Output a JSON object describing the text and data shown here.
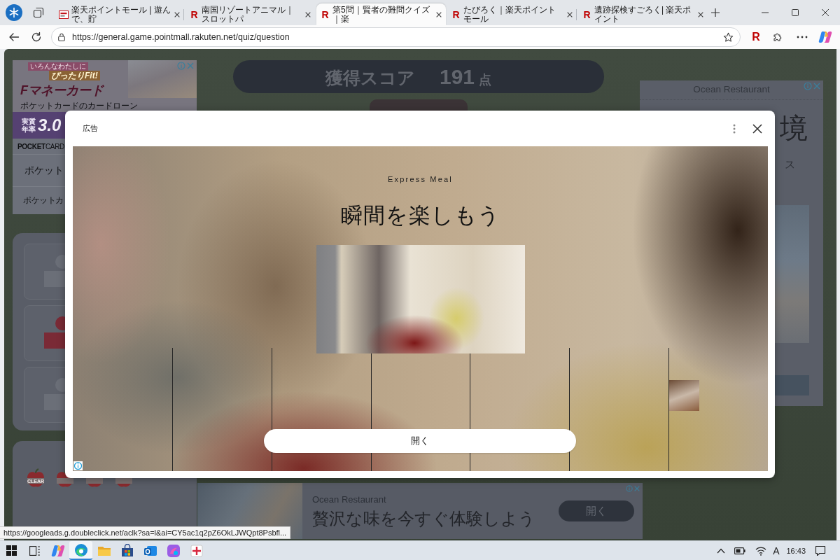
{
  "browser": {
    "tabs": [
      {
        "kind": "mall",
        "title": "楽天ポイントモール | 遊んで、貯",
        "selected": false
      },
      {
        "kind": "letter",
        "favicon": "R",
        "title": "南国リゾートアニマル｜スロットパ",
        "selected": false
      },
      {
        "kind": "letter",
        "favicon": "R",
        "title": "第5問｜賢者の難問クイズ｜楽",
        "selected": true
      },
      {
        "kind": "letter",
        "favicon": "R",
        "title": "たびろく｜楽天ポイントモール",
        "selected": false
      },
      {
        "kind": "letter",
        "favicon": "R",
        "title": "遺跡探検すごろく| 楽天ポイント",
        "selected": false
      }
    ],
    "address_bar": {
      "url": "https://general.game.pointmall.rakuten.net/quiz/question"
    },
    "extension_label": "R",
    "status_link": "https://googleads.g.doubleclick.net/aclk?sa=l&ai=CY5ac1q2pZ6OkLJWQpt8Psbfl..."
  },
  "page": {
    "score_bar": {
      "label": "獲得スコア",
      "value": "191",
      "unit": "点"
    },
    "left_ad": {
      "tagline_1": "いろんなわたしに",
      "tagline_2": "ぴったりFit!",
      "product": "Fマネーカード",
      "subtitle": "ポケットカードのカードローン",
      "rate_label_1": "実質",
      "rate_label_2": "年率",
      "rate_value": "3.0",
      "brand": "**POCKET**CARD",
      "headline": "ポケット",
      "description": "ポケットカ"
    },
    "left_panel": {
      "option_cards": [
        {
          "color": "#6b6f78"
        },
        {
          "color": "#7a2a36"
        },
        {
          "color": "#6b6f78"
        }
      ],
      "badges": [
        {
          "kind": "labeled",
          "label": "CLEAR"
        },
        {
          "kind": "plain"
        },
        {
          "kind": "plain"
        },
        {
          "kind": "plain"
        }
      ]
    },
    "right_ad": {
      "advertiser": "Ocean Restaurant",
      "headline_fragment": "境",
      "text_fragment": "ス"
    },
    "bottom_ad": {
      "advertiser": "Ocean Restaurant",
      "headline": "贅沢な味を今すぐ体験しよう",
      "button": "開く"
    }
  },
  "modal": {
    "label": "広告",
    "ad": {
      "brand": "Express Meal",
      "headline": "瞬間を楽しもう",
      "button": "開く"
    }
  },
  "taskbar": {
    "apps": [
      {
        "kind": "copilot",
        "selected": false
      },
      {
        "kind": "edge",
        "selected": true
      },
      {
        "kind": "explorer",
        "selected": false
      },
      {
        "kind": "store",
        "selected": false
      },
      {
        "kind": "outlook",
        "selected": false
      },
      {
        "kind": "copilot-app",
        "selected": false
      },
      {
        "kind": "snip",
        "selected": false
      }
    ],
    "ime": "A",
    "time": "16:43"
  }
}
